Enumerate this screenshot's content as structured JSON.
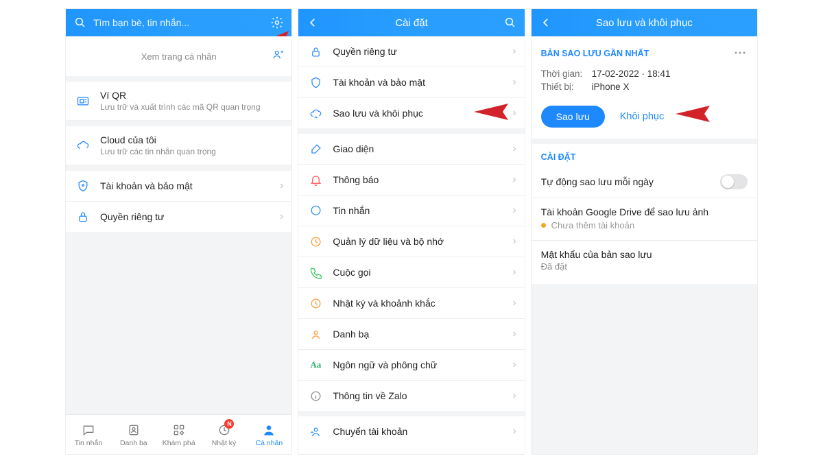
{
  "screen1": {
    "search_placeholder": "Tìm bạn bè, tin nhắn...",
    "profile_link": "Xem trang cá nhân",
    "rows": {
      "qr": {
        "title": "Ví QR",
        "sub": "Lưu trữ và xuất trình các mã QR quan trọng"
      },
      "cloud": {
        "title": "Cloud của tôi",
        "sub": "Lưu trữ các tin nhắn quan trọng"
      },
      "security": {
        "title": "Tài khoản và bảo mật"
      },
      "privacy": {
        "title": "Quyền riêng tư"
      }
    },
    "tabs": {
      "messages": "Tin nhắn",
      "contacts": "Danh bạ",
      "discover": "Khám phá",
      "diary": "Nhật ký",
      "me": "Cá nhân",
      "badge": "N"
    }
  },
  "screen2": {
    "title": "Cài đặt",
    "rows": {
      "privacy": "Quyền riêng tư",
      "security": "Tài khoản và bảo mật",
      "backup": "Sao lưu và khôi phục",
      "ui": "Giao diện",
      "notify": "Thông báo",
      "message": "Tin nhắn",
      "data": "Quản lý dữ liệu và bộ nhớ",
      "call": "Cuộc gọi",
      "diary": "Nhật ký và khoảnh khắc",
      "contacts": "Danh bạ",
      "lang": "Ngôn ngữ và phông chữ",
      "about": "Thông tin về Zalo",
      "switch": "Chuyển tài khoản"
    }
  },
  "screen3": {
    "title": "Sao lưu và khôi phục",
    "section": "BẢN SAO LƯU GẦN NHẤT",
    "time_k": "Thời gian:",
    "time_v": "17-02-2022 · 18:41",
    "device_k": "Thiết bị:",
    "device_v": "iPhone X",
    "btn_backup": "Sao lưu",
    "btn_restore": "Khôi phục",
    "settings_h": "CÀI ĐẶT",
    "auto": "Tự động sao lưu mỗi ngày",
    "drive": "Tài khoản Google Drive để sao lưu ảnh",
    "drive_sub": "Chưa thêm tài khoản",
    "pwd": "Mật khẩu của bản sao lưu",
    "pwd_sub": "Đã đặt"
  }
}
